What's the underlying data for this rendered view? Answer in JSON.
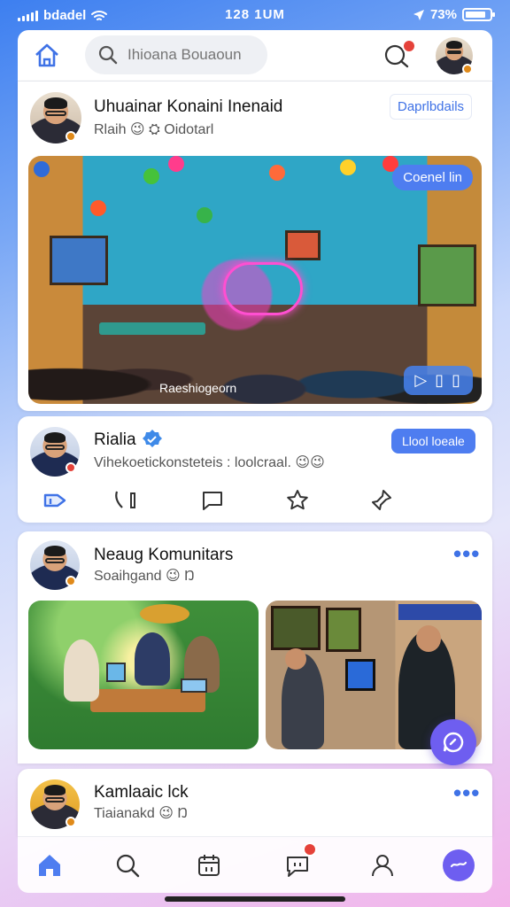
{
  "status": {
    "carrier": "bdadel",
    "time": "128 1UM",
    "battery": "73%"
  },
  "header": {
    "search_placeholder": "Ihioana Bouaoun",
    "notification_count": ""
  },
  "post1": {
    "author": "Uhuainar Konaini Inenaid",
    "subtitle": "Rlaih 😉 ⛭ Oidotarl",
    "link_label": "Daprlbdails",
    "photo_button": "Coenel lin",
    "photo_caption": "Raeshiogeorn",
    "play_chip": "▷ ▯ ▯"
  },
  "post2": {
    "author": "Rialia",
    "subtitle": "Vihekoetickonsteteis : loolcraal. 😉😉",
    "action_button": "Llool loeale"
  },
  "post3": {
    "author": "Neaug Komunitars",
    "subtitle": "Soaihgand 😉 Ŋ"
  },
  "post4": {
    "author": "Kamlaaic lck",
    "subtitle": "Tiaianakd 😉 Ŋ"
  },
  "colors": {
    "accent": "#4e7df0",
    "fab": "#6e5ef0",
    "badge": "#e5423a"
  }
}
